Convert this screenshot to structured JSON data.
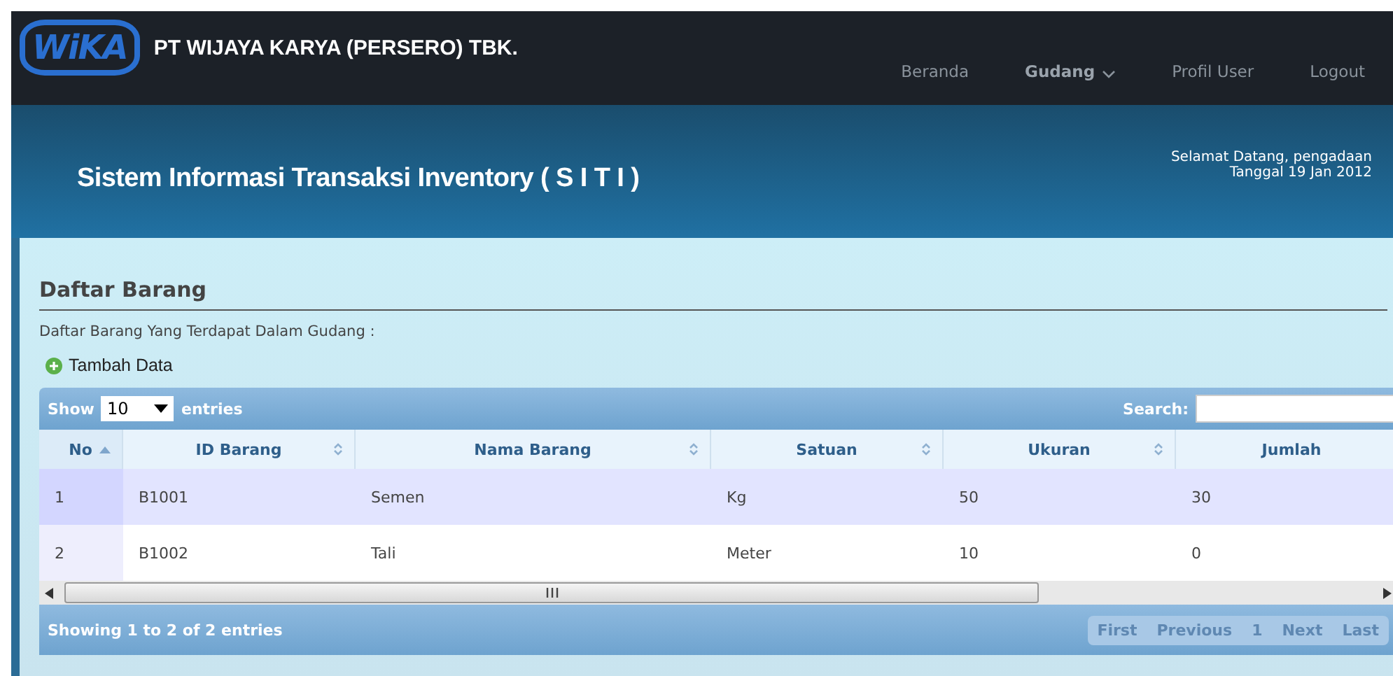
{
  "brand": {
    "logo": "WiKA",
    "company": "PT WIJAYA KARYA (PERSERO) TBK."
  },
  "nav": [
    {
      "label": "Beranda",
      "selected": false,
      "dropdown": false
    },
    {
      "label": "Gudang",
      "selected": true,
      "dropdown": true
    },
    {
      "label": "Profil User",
      "selected": false,
      "dropdown": false
    },
    {
      "label": "Logout",
      "selected": false,
      "dropdown": false
    }
  ],
  "header": {
    "title": "Sistem Informasi Transaksi Inventory ( S I T I )",
    "greeting": "Selamat Datang, pengadaan",
    "date": "Tanggal 19 Jan 2012"
  },
  "page": {
    "title": "Daftar Barang",
    "description": "Daftar Barang Yang Terdapat Dalam Gudang :",
    "add_button": "Tambah Data"
  },
  "table": {
    "show_label": "Show",
    "page_size": "10",
    "entries_label": "entries",
    "search_label": "Search:",
    "columns": [
      {
        "label": "No",
        "sortable": true,
        "sorted": true
      },
      {
        "label": "ID Barang",
        "sortable": true,
        "sorted": false
      },
      {
        "label": "Nama Barang",
        "sortable": true,
        "sorted": false
      },
      {
        "label": "Satuan",
        "sortable": true,
        "sorted": false
      },
      {
        "label": "Ukuran",
        "sortable": true,
        "sorted": false
      },
      {
        "label": "Jumlah",
        "sortable": false,
        "sorted": false
      }
    ],
    "rows": [
      [
        "1",
        "B1001",
        "Semen",
        "Kg",
        "50",
        "30"
      ],
      [
        "2",
        "B1002",
        "Tali",
        "Meter",
        "10",
        "0"
      ]
    ],
    "info": "Showing 1 to 2 of 2 entries",
    "pagination": [
      {
        "label": "First",
        "disabled": true
      },
      {
        "label": "Previous",
        "disabled": true
      },
      {
        "label": "1",
        "disabled": true
      },
      {
        "label": "Next",
        "disabled": true
      },
      {
        "label": "Last",
        "disabled": true
      }
    ]
  }
}
